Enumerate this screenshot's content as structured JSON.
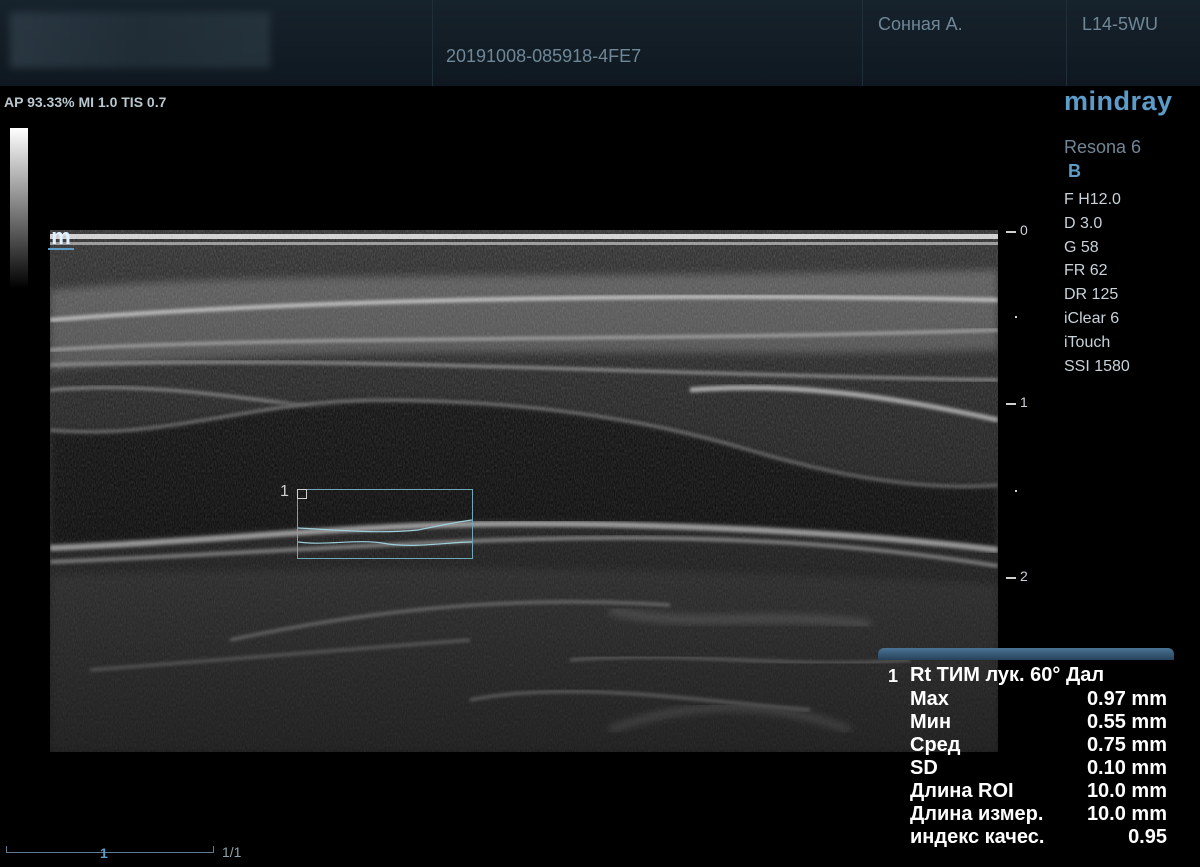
{
  "header": {
    "study_id": "20191008-085918-4FE7",
    "patient": "Сонная А.",
    "probe": "L14-5WU"
  },
  "acoustic_output": "AP 93.33%  MI 1.0 TIS 0.7",
  "brand": "mindray",
  "model": "Resona 6",
  "mode": "B",
  "params": [
    "F H12.0",
    "D 3.0",
    "G 58",
    "FR 62",
    "DR 125",
    "iClear 6",
    "iTouch",
    "SSI 1580"
  ],
  "depth_scale": [
    "0",
    "1",
    "2"
  ],
  "roi_number": "1",
  "measurement": {
    "number": "1",
    "title": "Rt ТИМ лук. 60° Дал",
    "rows": [
      {
        "label": "Max",
        "value": "0.97 mm"
      },
      {
        "label": "Мин",
        "value": "0.55 mm"
      },
      {
        "label": "Сред",
        "value": "0.75 mm"
      },
      {
        "label": "SD",
        "value": "0.10 mm"
      },
      {
        "label": "Длина ROI",
        "value": "10.0 mm"
      },
      {
        "label": "Длина измер.",
        "value": "10.0 mm"
      },
      {
        "label": "индекс качес.",
        "value": "0.95"
      }
    ]
  },
  "page_counter": "1/1",
  "icons": {
    "mark": "m",
    "cine": "1"
  }
}
